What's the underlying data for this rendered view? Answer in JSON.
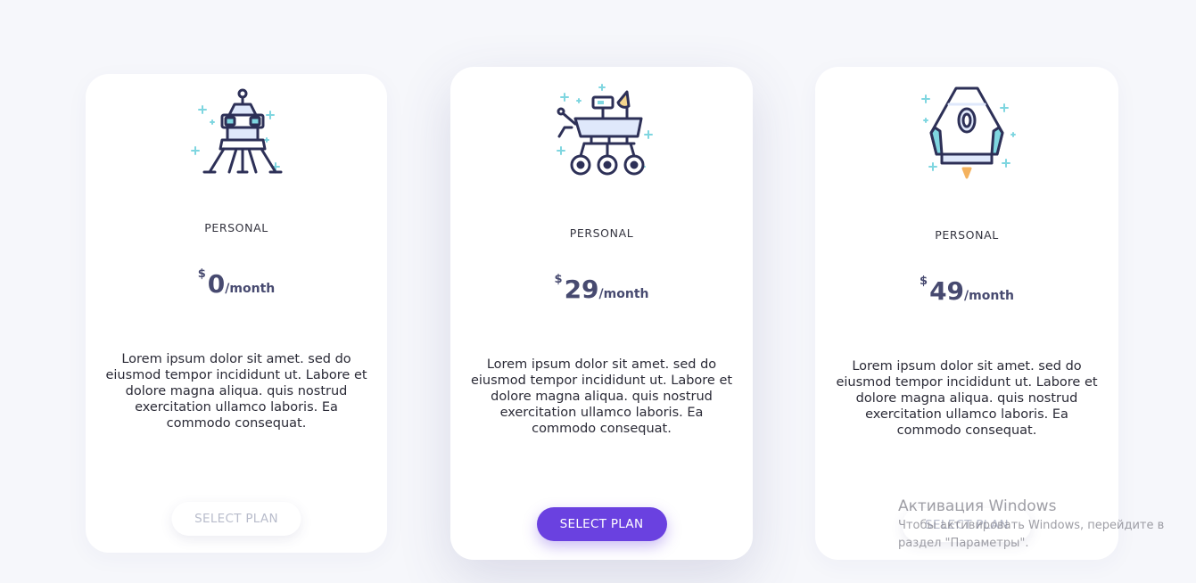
{
  "plans": [
    {
      "icon": "lunar-lander-icon",
      "name": "PERSONAL",
      "currency": "$",
      "amount": "0",
      "period": "/month",
      "description": "Lorem ipsum dolor sit amet. sed do eiusmod tempor incididunt ut. Labore et dolore magna aliqua. quis nostrud exercitation ullamco laboris. Ea commodo consequat.",
      "button": "SELECT PLAN"
    },
    {
      "icon": "mars-rover-icon",
      "name": "PERSONAL",
      "currency": "$",
      "amount": "29",
      "period": "/month",
      "description": "Lorem ipsum dolor sit amet. sed do eiusmod tempor incididunt ut. Labore et dolore magna aliqua. quis nostrud exercitation ullamco laboris. Ea commodo consequat.",
      "button": "SELECT PLAN"
    },
    {
      "icon": "space-capsule-icon",
      "name": "PERSONAL",
      "currency": "$",
      "amount": "49",
      "period": "/month",
      "description": "Lorem ipsum dolor sit amet. sed do eiusmod tempor incididunt ut. Labore et dolore magna aliqua. quis nostrud exercitation ullamco laboris. Ea commodo consequat.",
      "button": "SELECT PLAN"
    }
  ],
  "watermark": {
    "title": "Активация Windows",
    "line1": "Чтобы активировать Windows, перейдите в",
    "line2": "раздел \"Параметры\"."
  },
  "colors": {
    "background": "#f6f7fb",
    "accent": "#6a41e0",
    "price": "#474a70",
    "icon_outline": "#2d3057",
    "icon_cyan": "#7fd6e0",
    "icon_fill": "#dfe8fb"
  }
}
